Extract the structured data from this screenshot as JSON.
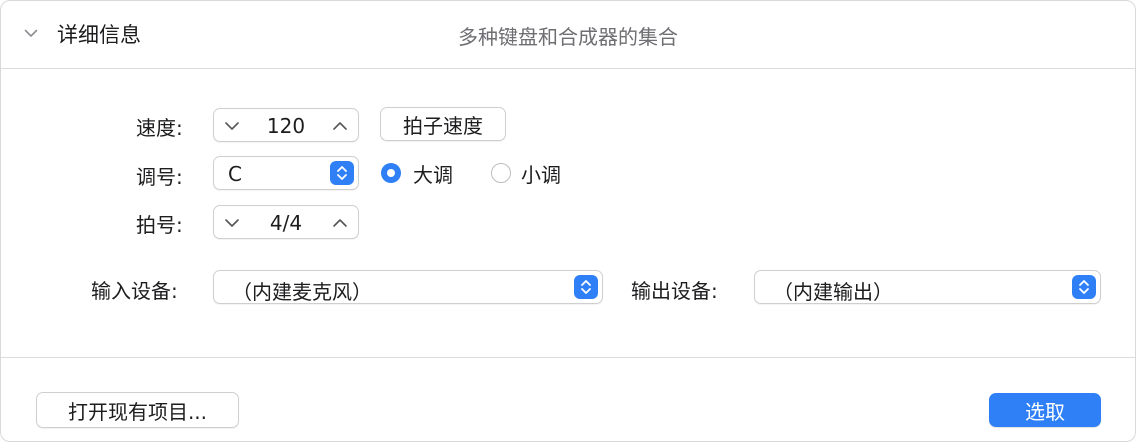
{
  "header": {
    "title": "详细信息",
    "subtitle": "多种键盘和合成器的集合"
  },
  "tempo": {
    "label": "速度:",
    "value": "120",
    "tap_button": "拍子速度"
  },
  "key": {
    "label": "调号:",
    "value": "C",
    "mode_options": [
      {
        "label": "大调",
        "selected": true
      },
      {
        "label": "小调",
        "selected": false
      }
    ]
  },
  "time_signature": {
    "label": "拍号:",
    "value": "4/4"
  },
  "input_device": {
    "label": "输入设备:",
    "value": "（内建麦克风）"
  },
  "output_device": {
    "label": "输出设备:",
    "value": "（内建输出）"
  },
  "footer": {
    "open_existing": "打开现有项目...",
    "choose": "选取"
  },
  "colors": {
    "accent": "#2f80f7",
    "text": "#1d1d1f",
    "subtitle": "#6e6e73"
  },
  "icons": {
    "disclosure": "chevron-down-icon",
    "stepper_down": "chevron-down-icon",
    "stepper_up": "chevron-up-icon",
    "select_arrows": "up-down-arrows-icon"
  }
}
